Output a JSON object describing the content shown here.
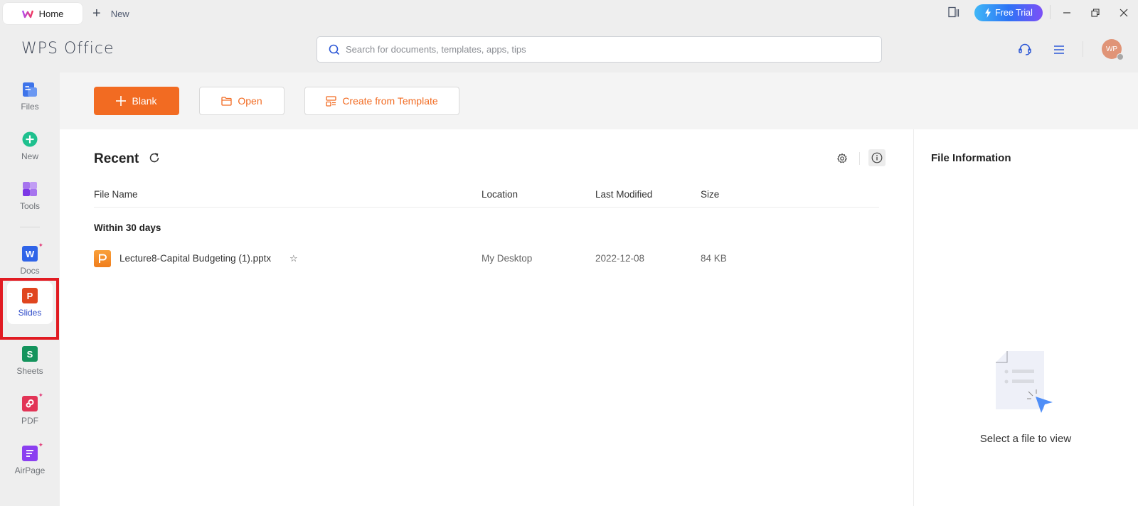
{
  "titlebar": {
    "tabs": [
      {
        "label": "Home",
        "icon": "wps-logo-icon",
        "active": true
      },
      {
        "label": "New",
        "icon": "plus-icon"
      }
    ],
    "free_trial_label": "Free Trial",
    "window_controls": [
      "minimize",
      "restore",
      "close"
    ]
  },
  "header": {
    "app_name": "WPS Office",
    "search": {
      "placeholder": "Search for documents, templates, apps, tips",
      "value": ""
    },
    "avatar_initials": "WP"
  },
  "sidebar": {
    "items": [
      {
        "label": "Files",
        "icon": "files-icon"
      },
      {
        "label": "New",
        "icon": "new-icon"
      },
      {
        "label": "Tools",
        "icon": "tools-icon"
      },
      {
        "label": "Docs",
        "icon": "docs-icon",
        "glyph": "W"
      },
      {
        "label": "Slides",
        "icon": "slides-icon",
        "glyph": "P",
        "active": true
      },
      {
        "label": "Sheets",
        "icon": "sheets-icon",
        "glyph": "S"
      },
      {
        "label": "PDF",
        "icon": "pdf-icon"
      },
      {
        "label": "AirPage",
        "icon": "airpage-icon"
      }
    ]
  },
  "actions": {
    "blank_label": "Blank",
    "open_label": "Open",
    "template_label": "Create from Template"
  },
  "recent": {
    "title": "Recent",
    "columns": [
      "File Name",
      "Location",
      "Last Modified",
      "Size"
    ],
    "groups": [
      {
        "title": "Within 30 days",
        "files": [
          {
            "name": "Lecture8-Capital Budgeting (1).pptx",
            "location": "My Desktop",
            "modified": "2022-12-08",
            "size": "84 KB",
            "type": "pptx"
          }
        ]
      }
    ]
  },
  "info_panel": {
    "title": "File Information",
    "empty_text": "Select a file to view"
  },
  "colors": {
    "accent": "#f26b22",
    "brand_blue": "#2b48c8",
    "highlight": "#e11b22"
  }
}
